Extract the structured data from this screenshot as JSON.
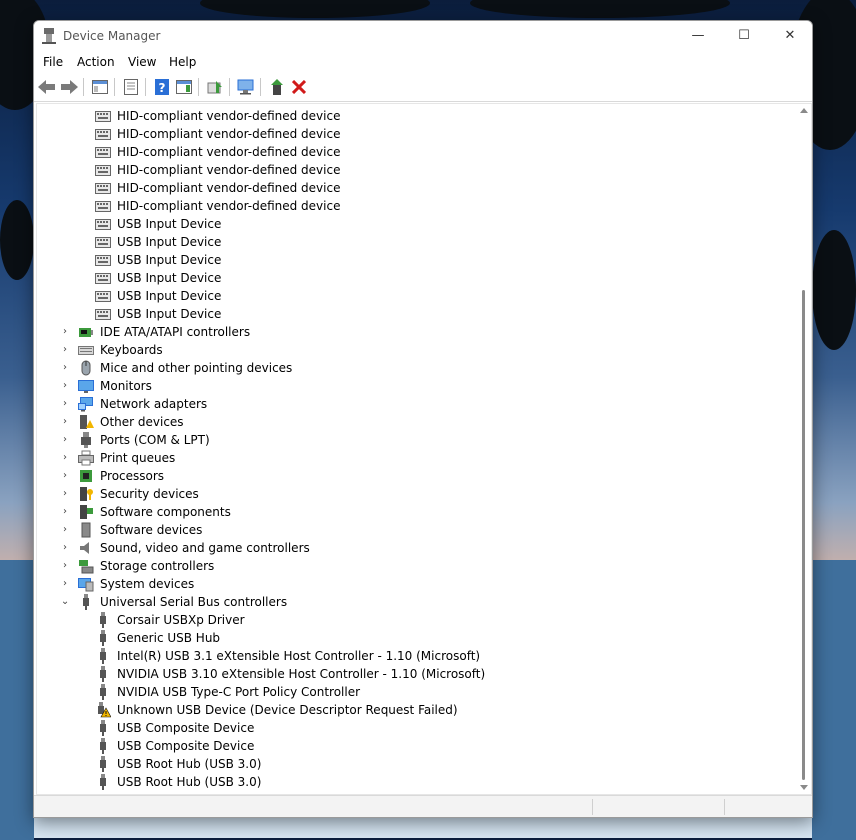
{
  "window": {
    "title": "Device Manager",
    "controls": {
      "minimize": "—",
      "maximize": "☐",
      "close": "✕"
    }
  },
  "menu": [
    {
      "label": "File"
    },
    {
      "label": "Action"
    },
    {
      "label": "View"
    },
    {
      "label": "Help"
    }
  ],
  "toolbar": {
    "buttons": [
      {
        "name": "back-icon"
      },
      {
        "name": "forward-icon"
      },
      {
        "name": "show-hide-console-tree-icon"
      },
      {
        "name": "properties-icon"
      },
      {
        "name": "help-icon"
      },
      {
        "name": "action-pane-icon"
      },
      {
        "name": "update-driver-icon"
      },
      {
        "name": "scan-hardware-icon"
      },
      {
        "name": "enable-device-icon"
      },
      {
        "name": "uninstall-device-icon"
      }
    ]
  },
  "tree": {
    "hid_children": [
      {
        "label": "HID-compliant vendor-defined device"
      },
      {
        "label": "HID-compliant vendor-defined device"
      },
      {
        "label": "HID-compliant vendor-defined device"
      },
      {
        "label": "HID-compliant vendor-defined device"
      },
      {
        "label": "HID-compliant vendor-defined device"
      },
      {
        "label": "HID-compliant vendor-defined device"
      },
      {
        "label": "USB Input Device"
      },
      {
        "label": "USB Input Device"
      },
      {
        "label": "USB Input Device"
      },
      {
        "label": "USB Input Device"
      },
      {
        "label": "USB Input Device"
      },
      {
        "label": "USB Input Device"
      }
    ],
    "categories": [
      {
        "label": "IDE ATA/ATAPI controllers",
        "icon": "ide-controller-icon"
      },
      {
        "label": "Keyboards",
        "icon": "keyboard-icon"
      },
      {
        "label": "Mice and other pointing devices",
        "icon": "mouse-icon"
      },
      {
        "label": "Monitors",
        "icon": "monitor-icon"
      },
      {
        "label": "Network adapters",
        "icon": "network-adapter-icon"
      },
      {
        "label": "Other devices",
        "icon": "other-devices-icon"
      },
      {
        "label": "Ports (COM & LPT)",
        "icon": "port-icon"
      },
      {
        "label": "Print queues",
        "icon": "printer-icon"
      },
      {
        "label": "Processors",
        "icon": "processor-icon"
      },
      {
        "label": "Security devices",
        "icon": "security-device-icon"
      },
      {
        "label": "Software components",
        "icon": "software-component-icon"
      },
      {
        "label": "Software devices",
        "icon": "software-device-icon"
      },
      {
        "label": "Sound, video and game controllers",
        "icon": "speaker-icon"
      },
      {
        "label": "Storage controllers",
        "icon": "storage-controller-icon"
      },
      {
        "label": "System devices",
        "icon": "system-devices-icon"
      }
    ],
    "usb": {
      "label": "Universal Serial Bus controllers",
      "children": [
        {
          "label": "Corsair USBXp Driver",
          "warning": false
        },
        {
          "label": "Generic USB Hub",
          "warning": false
        },
        {
          "label": "Intel(R) USB 3.1 eXtensible Host Controller - 1.10 (Microsoft)",
          "warning": false
        },
        {
          "label": "NVIDIA USB 3.10 eXtensible Host Controller - 1.10 (Microsoft)",
          "warning": false
        },
        {
          "label": "NVIDIA USB Type-C Port Policy Controller",
          "warning": false
        },
        {
          "label": "Unknown USB Device (Device Descriptor Request Failed)",
          "warning": true
        },
        {
          "label": "USB Composite Device",
          "warning": false
        },
        {
          "label": "USB Composite Device",
          "warning": false
        },
        {
          "label": "USB Root Hub (USB 3.0)",
          "warning": false
        },
        {
          "label": "USB Root Hub (USB 3.0)",
          "warning": false
        }
      ]
    }
  },
  "colors": {
    "accent": "#2a6fd6",
    "warning": "#f2b600",
    "uninstall_red": "#d11a1a"
  }
}
